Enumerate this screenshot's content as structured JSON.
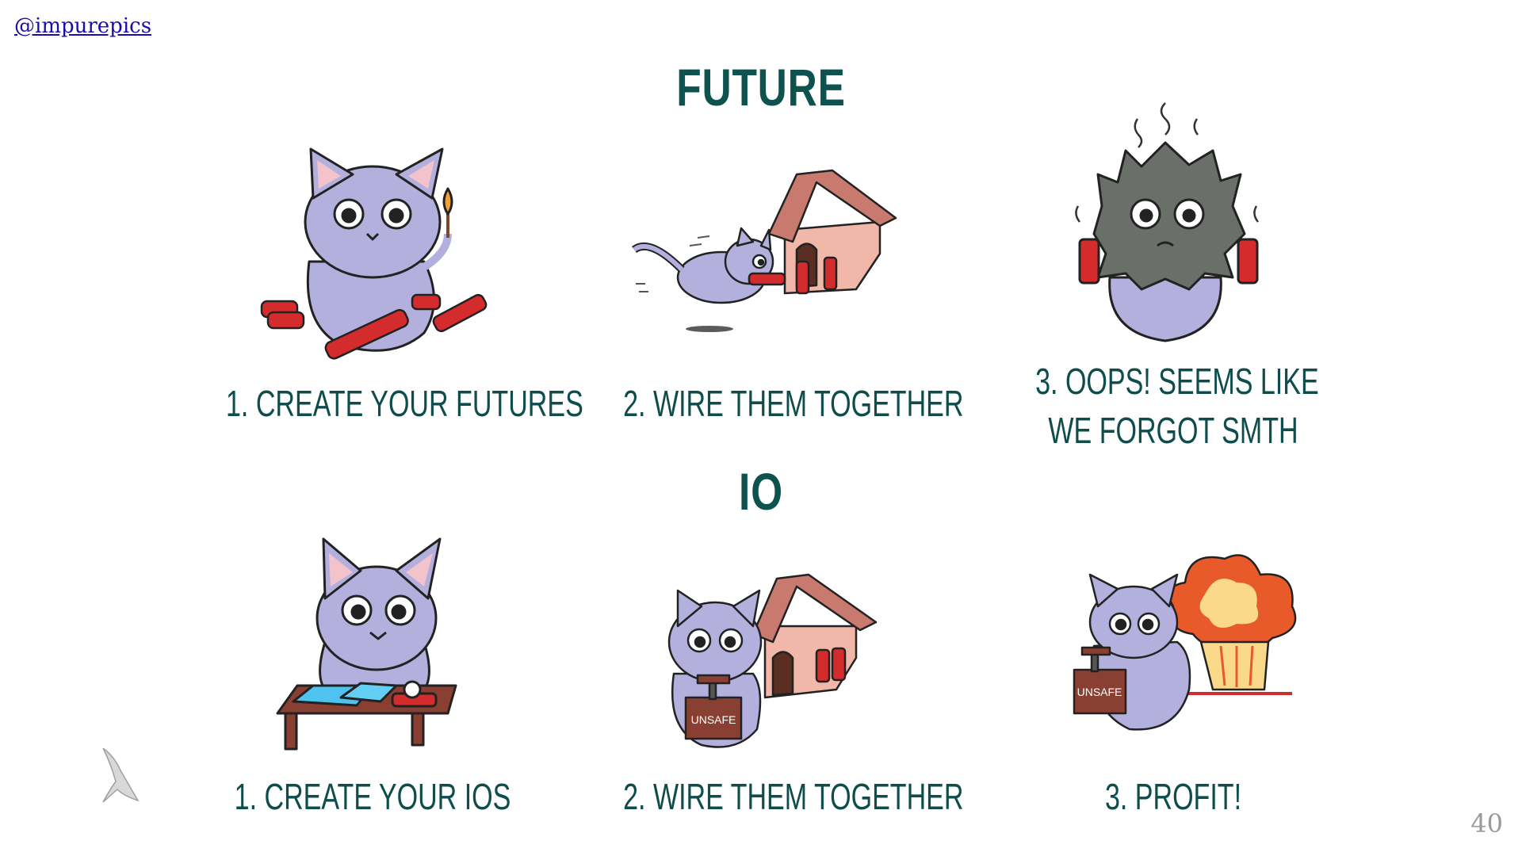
{
  "link": {
    "text": "@impurepics"
  },
  "sections": {
    "future": {
      "title": "FUTURE",
      "steps": [
        {
          "caption": "1. CREATE YOUR FUTURES"
        },
        {
          "caption": "2. WIRE THEM TOGETHER"
        },
        {
          "caption_line1": "3. OOPS! SEEMS LIKE",
          "caption_line2": "WE FORGOT SMTH"
        }
      ]
    },
    "io": {
      "title": "IO",
      "steps": [
        {
          "caption": "1. CREATE YOUR IOS"
        },
        {
          "caption": "2. WIRE THEM TOGETHER"
        },
        {
          "caption": "3. PROFIT!"
        }
      ],
      "box_label": "UNSAFE"
    }
  },
  "page_number": "40",
  "colors": {
    "title": "#0e5250",
    "cat_body": "#b3b0dd",
    "dynamite": "#d42c2c",
    "doghouse": "#f1b7a8",
    "roof": "#c97a6e",
    "burnt_fur": "#6a6f6a",
    "explosion_outer": "#e85a2a",
    "explosion_inner": "#fbd98a"
  },
  "icons": [
    "cat-icon",
    "dynamite-icon",
    "match-icon",
    "doghouse-icon",
    "explosion-icon",
    "detonator-box-icon",
    "table-icon",
    "logo-icon"
  ]
}
